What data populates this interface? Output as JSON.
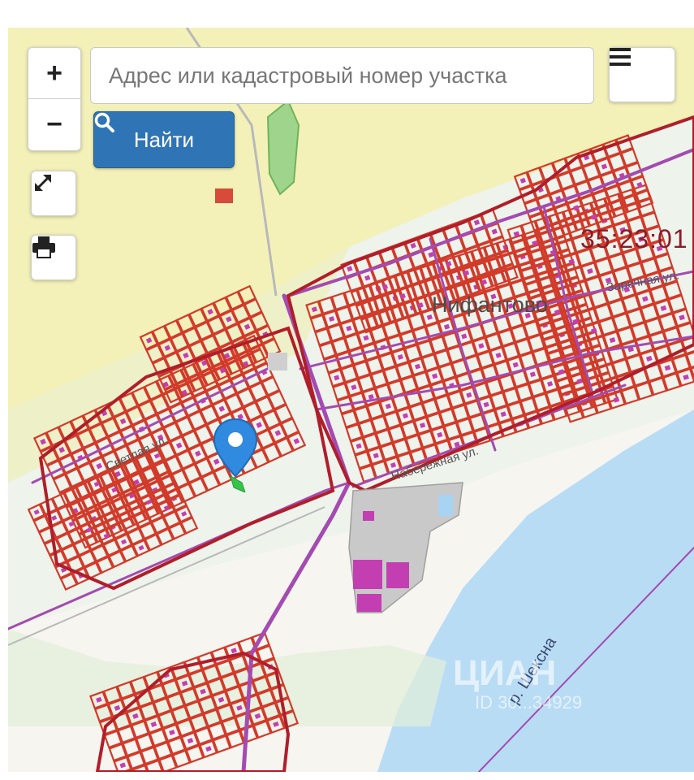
{
  "search": {
    "placeholder": "Адрес или кадастровый номер участка"
  },
  "buttons": {
    "find_label": "Найти",
    "zoom_in": "+",
    "zoom_out": "−"
  },
  "map": {
    "village_name": "Нифантово",
    "cadastral_quarter": "35:23:01",
    "river_label": "р. Шексна",
    "streets": [
      "Светлая ул.",
      "Набережная ул.",
      "Заречная ул."
    ],
    "watermark": "ЦИАН",
    "watermark_id": "ID 30...34929"
  },
  "colors": {
    "water": "#b9dcf5",
    "parcel": "#d23a2a",
    "boundary": "#b01e2a",
    "road": "#a34bb0",
    "accent": "#2f75b5",
    "forest": "#f2f0b4",
    "pin": "#2f8ae0"
  }
}
